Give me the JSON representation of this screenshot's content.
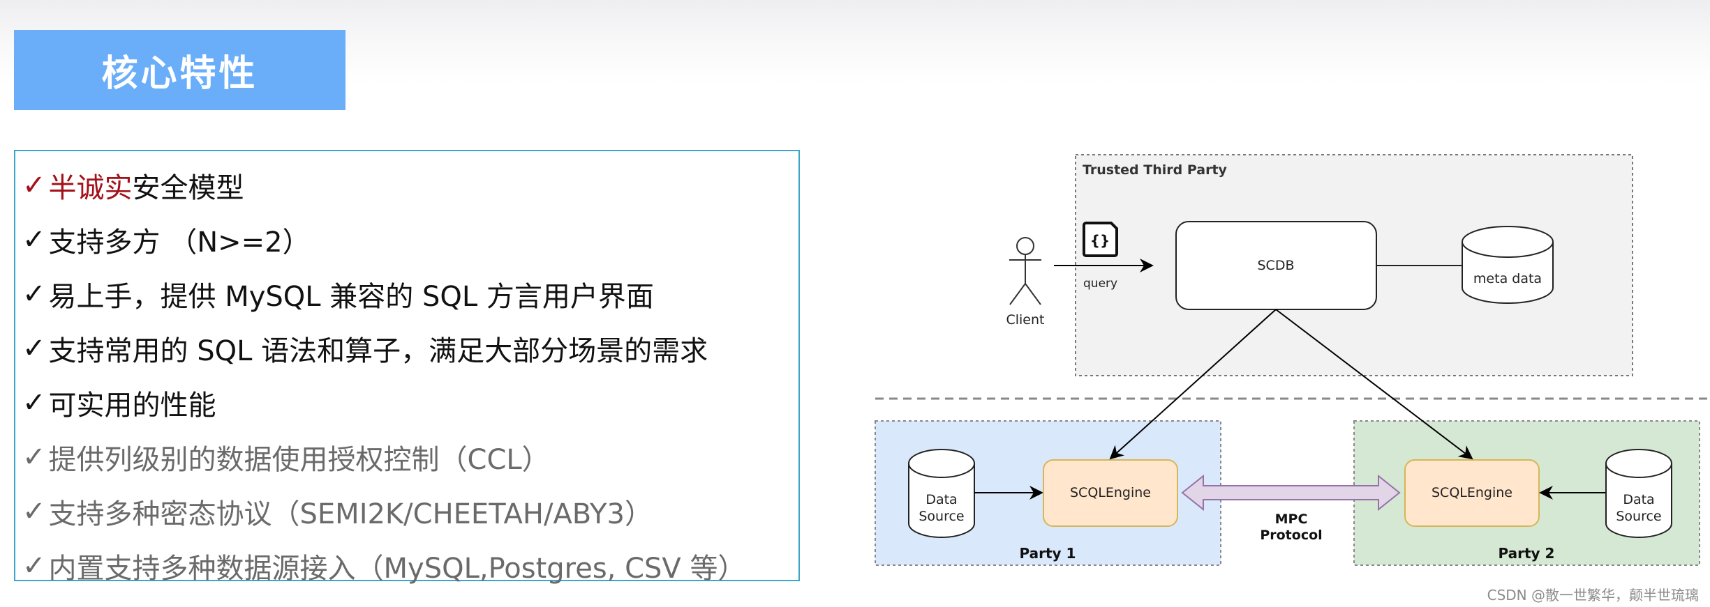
{
  "title": "核心特性",
  "features": [
    {
      "check": "✓",
      "highlight": "半诚实",
      "text": "安全模型",
      "style": "dark"
    },
    {
      "check": "✓",
      "highlight": "",
      "text": "支持多方 （N>=2）",
      "style": "dark"
    },
    {
      "check": "✓",
      "highlight": "",
      "text": "易上手，提供 MySQL 兼容的 SQL 方言用户界面",
      "style": "dark"
    },
    {
      "check": "✓",
      "highlight": "",
      "text": "支持常用的 SQL 语法和算子，满足大部分场景的需求",
      "style": "dark"
    },
    {
      "check": "✓",
      "highlight": "",
      "text": "可实用的性能",
      "style": "dark"
    },
    {
      "check": "✓",
      "highlight": "",
      "text": "提供列级别的数据使用授权控制（CCL）",
      "style": "grey"
    },
    {
      "check": "✓",
      "highlight": "",
      "text": "支持多种密态协议（SEMI2K/CHEETAH/ABY3）",
      "style": "grey"
    },
    {
      "check": "✓",
      "highlight": "",
      "text": "内置支持多种数据源接入（MySQL,Postgres, CSV 等）",
      "style": "grey"
    }
  ],
  "diagram": {
    "trusted_label": "Trusted Third Party",
    "client_label": "Client",
    "query_label": "query",
    "query_icon": "{}",
    "scdb_label": "SCDB",
    "meta_label": "meta data",
    "party1_label": "Party 1",
    "party2_label": "Party 2",
    "engine_label": "SCQLEngine",
    "datasource_line1": "Data",
    "datasource_line2": "Source",
    "mpc_line1": "MPC",
    "mpc_line2": "Protocol",
    "colors": {
      "trusted_fill": "#f2f2f2",
      "party1_fill": "#dae8fc",
      "party2_fill": "#d5e8d4",
      "engine_fill": "#ffe6cc",
      "engine_stroke": "#d6b656",
      "mpc_fill": "#e1d5e7",
      "mpc_stroke": "#9673a6"
    }
  },
  "watermark": "CSDN @散一世繁华，颠半世琉璃"
}
